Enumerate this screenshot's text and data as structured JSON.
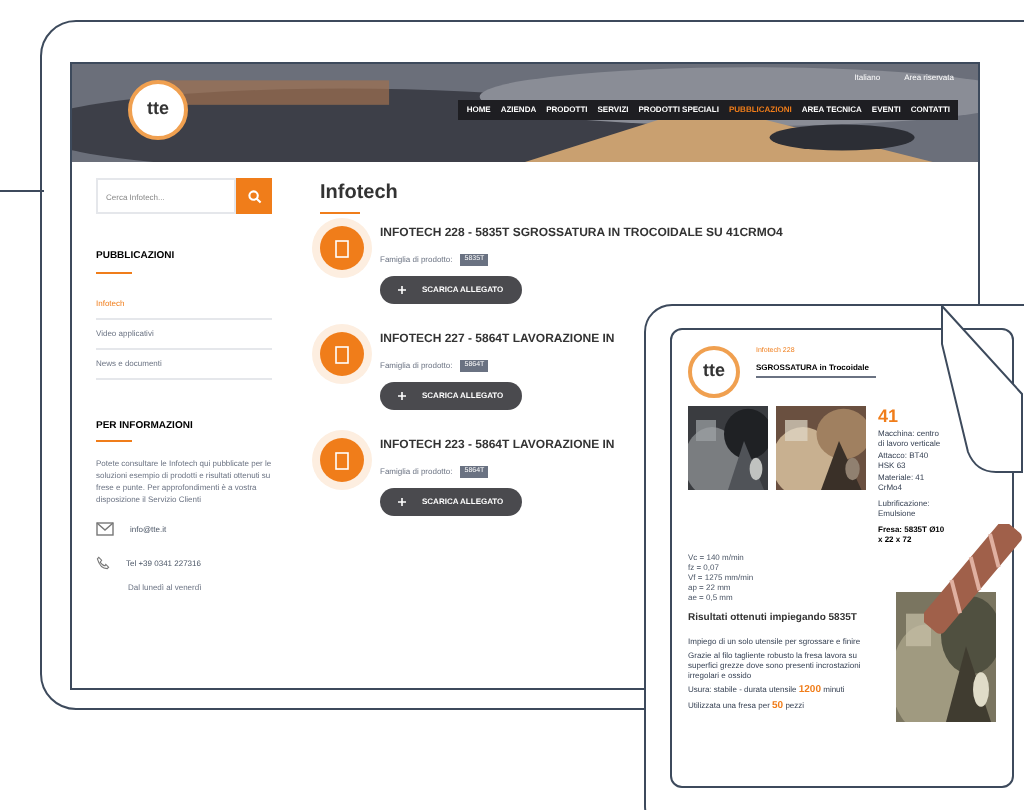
{
  "header": {
    "logo": "tte",
    "language": "Italiano",
    "reserved": "Area riservata",
    "nav": [
      {
        "label": "HOME",
        "selected": false
      },
      {
        "label": "AZIENDA",
        "selected": false
      },
      {
        "label": "PRODOTTI",
        "selected": false
      },
      {
        "label": "SERVIZI",
        "selected": false
      },
      {
        "label": "PRODOTTI SPECIALI",
        "selected": false
      },
      {
        "label": "PUBBLICAZIONI",
        "selected": true
      },
      {
        "label": "AREA TECNICA",
        "selected": false
      },
      {
        "label": "EVENTI",
        "selected": false
      },
      {
        "label": "CONTATTI",
        "selected": false
      }
    ]
  },
  "sidebar": {
    "search": {
      "placeholder": "Cerca Infotech..."
    },
    "publications": {
      "title": "PUBBLICAZIONI",
      "items": [
        {
          "label": "Infotech",
          "selected": true
        },
        {
          "label": "Video applicativi",
          "selected": false
        },
        {
          "label": "News e documenti",
          "selected": false
        }
      ]
    },
    "info": {
      "title": "PER INFORMAZIONI",
      "text": "Potete consultare le Infotech qui pubblicate per le soluzioni esempio di prodotti e risultati ottenuti su frese e punte. Per approfondimenti è a vostra disposizione il Servizio Clienti",
      "email": "info@tte.it",
      "phone": "Tel +39 0341 227316",
      "hours": "Dal lunedì al venerdì"
    }
  },
  "main": {
    "title": "Infotech",
    "items": [
      {
        "title": "INFOTECH 228 - 5835T SGROSSATURA IN TROCOIDALE SU 41CRMO4",
        "family": "Famiglia di prodotto:",
        "badge": "5835T",
        "button": "SCARICA ALLEGATO"
      },
      {
        "title": "INFOTECH 227 - 5864T LAVORAZIONE IN",
        "family": "Famiglia di prodotto:",
        "badge": "5864T",
        "button": "SCARICA ALLEGATO"
      },
      {
        "title": "INFOTECH 223 - 5864T LAVORAZIONE IN",
        "family": "Famiglia di prodotto:",
        "badge": "5864T",
        "button": "SCARICA ALLEGATO"
      }
    ]
  },
  "document": {
    "logo": "tte",
    "label": "Infotech 228",
    "title": "SGROSSATURA in Trocoidale",
    "number": "41",
    "specs": [
      "Macchina: centro di lavoro verticale",
      "Attacco: BT40 HSK 63",
      "Materiale: 41 CrMo4"
    ],
    "subtitle": "Lubrificazione: Emulsione",
    "tool": "Fresa: 5835T Ø10 x 22 x 72",
    "params": [
      "Vc = 140 m/min",
      "fz = 0,07",
      "Vf = 1275 mm/min",
      "ap = 22 mm",
      "ae = 0,5 mm"
    ],
    "heading": "Risultati ottenuti impiegando 5835T",
    "bullets": [
      "Impiego di un solo utensile per sgrossare e finire",
      "Grazie al filo tagliente robusto la fresa lavora su superfici grezze dove sono presenti incrostazioni irregolari e ossido",
      "Usura: stabile - durata utensile **1200** minuti",
      "Utilizzata una fresa per **50** pezzi"
    ]
  }
}
